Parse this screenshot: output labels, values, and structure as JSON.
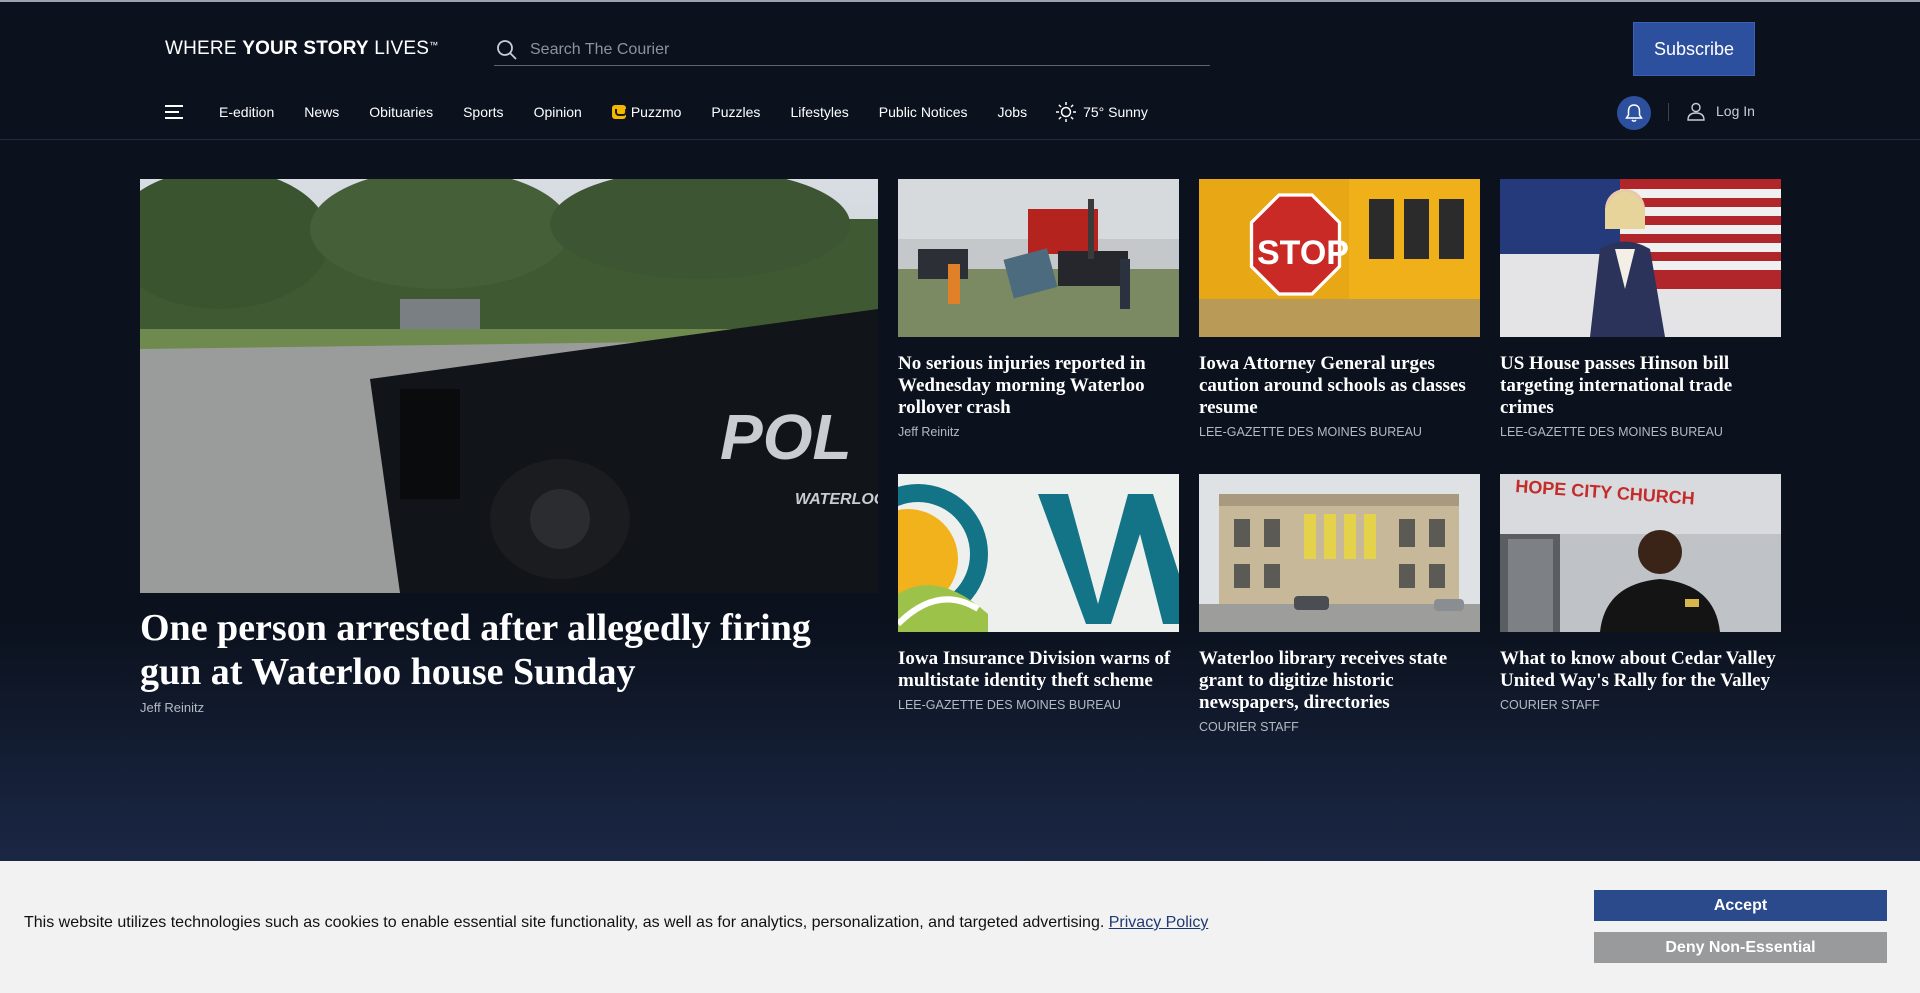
{
  "header": {
    "tagline_pre": "WHERE ",
    "tagline_bold": "YOUR STORY",
    "tagline_post": " LIVES",
    "tagline_mark": "™",
    "search_placeholder": "Search The Courier",
    "subscribe_label": "Subscribe"
  },
  "nav": {
    "items": [
      "E-edition",
      "News",
      "Obituaries",
      "Sports",
      "Opinion",
      "Puzzmo",
      "Puzzles",
      "Lifestyles",
      "Public Notices",
      "Jobs"
    ],
    "weather": "75° Sunny",
    "login_label": "Log In"
  },
  "hero": {
    "title": "One person arrested after allegedly firing gun at Waterloo house Sunday",
    "byline": "Jeff Reinitz",
    "image_text": "POL",
    "image_subtext": "WATERLOO"
  },
  "cards": [
    {
      "title": "No serious injuries reported in Wednesday morning Waterloo rollover crash",
      "byline": "Jeff Reinitz"
    },
    {
      "title": "Iowa Attorney General urges caution around schools as classes resume",
      "byline": "LEE-GAZETTE DES MOINES BUREAU",
      "image_text": "STOP"
    },
    {
      "title": "US House passes Hinson bill targeting international trade crimes",
      "byline": "LEE-GAZETTE DES MOINES BUREAU"
    },
    {
      "title": "Iowa Insurance Division warns of multistate identity theft scheme",
      "byline": "LEE-GAZETTE DES MOINES BUREAU"
    },
    {
      "title": "Waterloo library receives state grant to digitize historic newspapers, directories",
      "byline": "COURIER STAFF"
    },
    {
      "title": "What to know about Cedar Valley United Way's Rally for the Valley",
      "byline": "COURIER STAFF",
      "image_text": "HOPE CITY CHURCH"
    }
  ],
  "cookie": {
    "text": "This website utilizes technologies such as cookies to enable essential site functionality, as well as for analytics, personalization, and targeted advertising. ",
    "link": "Privacy Policy",
    "accept": "Accept",
    "deny": "Deny Non-Essential"
  }
}
